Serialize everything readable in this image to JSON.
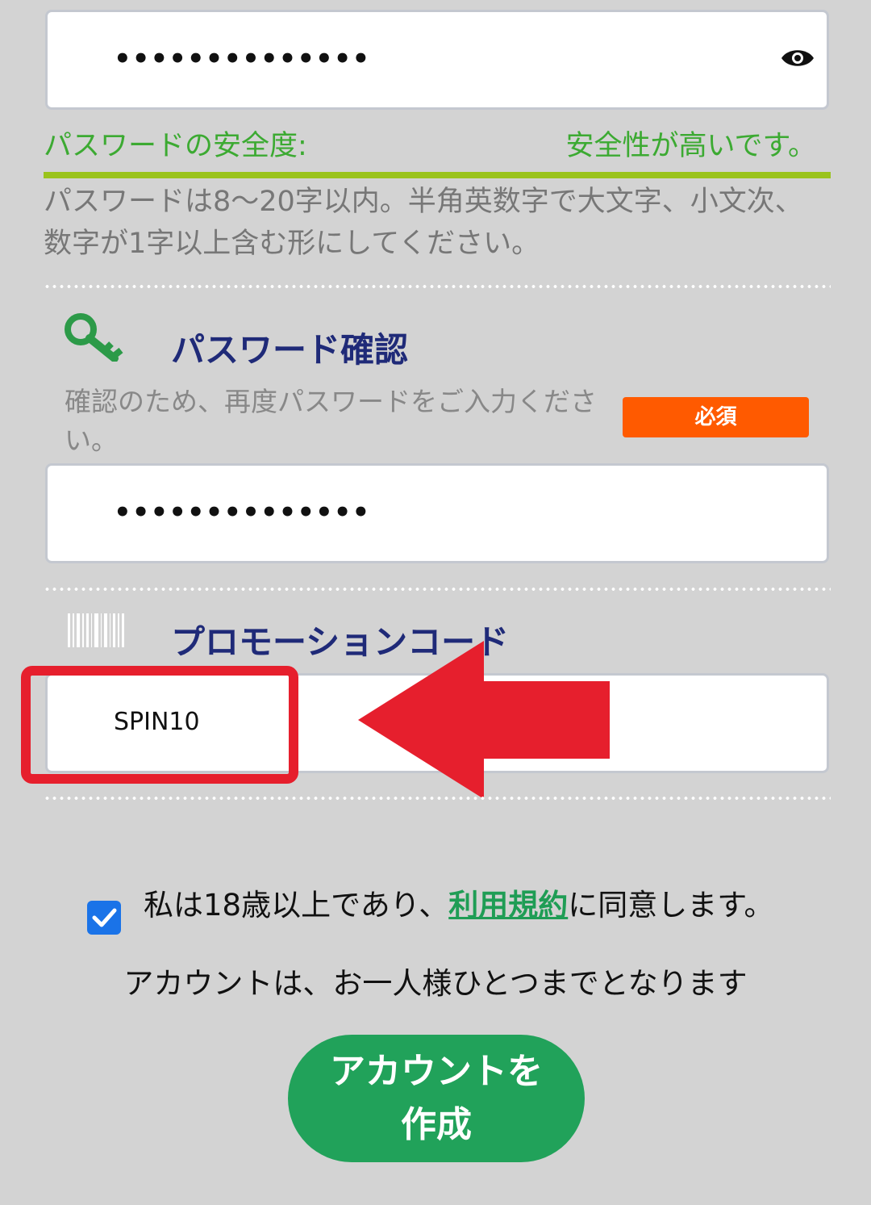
{
  "password_field": {
    "value": "••••••••••••••",
    "toggle_icon": "eye-icon"
  },
  "strength": {
    "label": "パスワードの安全度:",
    "value": "安全性が高いです。",
    "bar_color": "#9ac31c",
    "level": 1.0
  },
  "password_hint": "パスワードは8～20字以内。半角英数字で大文字、小文次、数字が1字以上含む形にしてください。",
  "confirm_section": {
    "icon": "key-icon",
    "title": "パスワード確認",
    "description": "確認のため、再度パスワードをご入力ください。",
    "required_badge": "必須",
    "value": "••••••••••••••"
  },
  "promo_section": {
    "icon": "barcode-icon",
    "title": "プロモーションコード",
    "value": "SPIN10",
    "highlight_color": "#e61f2d"
  },
  "consent": {
    "checked": true,
    "text_before": "私は18歳以上であり、",
    "link_text": "利用規約",
    "text_after": "に同意します。"
  },
  "account_note": "アカウントは、お一人様ひとつまでとなります",
  "create_button": {
    "label_line1": "アカウントを",
    "label_line2": "作成",
    "color": "#21a25a"
  }
}
